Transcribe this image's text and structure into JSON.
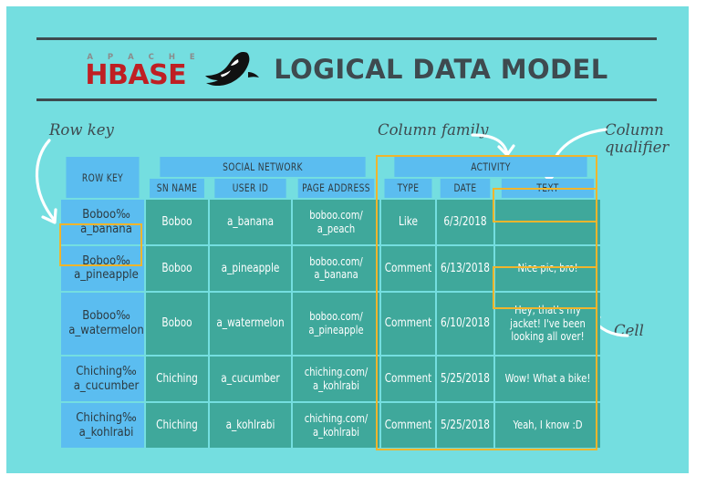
{
  "page": {
    "background": "#ffffff",
    "panel_color": "#74dee0",
    "header_rule_color": "#3e4a4f"
  },
  "header": {
    "logo": {
      "apache": "A P A C H E",
      "hbase": "HBASE",
      "orca_icon": "orca-whale-icon",
      "apache_color": "#8b8b8b",
      "hbase_color": "#bf1f23"
    },
    "title": "LOGICAL DATA MODEL",
    "title_color": "#3e4a4f"
  },
  "annotations": {
    "row_key": "Row key",
    "column_family": "Column family",
    "column_qualifier": "Column\nqualifier",
    "cell": "Cell",
    "highlight_color": "#f0b52c"
  },
  "table": {
    "colors": {
      "header_cell": "#5bbdf0",
      "rowkey_cell": "#5bbdf0",
      "data_cell": "#3fa89b",
      "grid_line": "#ffffff"
    },
    "group_headers": {
      "row_key": "ROW KEY",
      "social_network": "SOCIAL NETWORK",
      "activity": "ACTIVITY"
    },
    "qualifiers": {
      "sn_name": "SN NAME",
      "user_id": "USER ID",
      "page_address": "PAGE ADDRESS",
      "type": "TYPE",
      "date": "DATE",
      "text": "TEXT"
    },
    "rows": [
      {
        "row_key": "Boboo‰\na_banana",
        "sn_name": "Boboo",
        "user_id": "a_banana",
        "page_address": "boboo.com/\na_peach",
        "type": "Like",
        "date": "6/3/2018",
        "text": ""
      },
      {
        "row_key": "Boboo‰\na_pineapple",
        "sn_name": "Boboo",
        "user_id": "a_pineapple",
        "page_address": "boboo.com/\na_banana",
        "type": "Comment",
        "date": "6/13/2018",
        "text": "Nice pic, bro!"
      },
      {
        "row_key": "Boboo‰\na_watermelon",
        "sn_name": "Boboo",
        "user_id": "a_watermelon",
        "page_address": "boboo.com/\na_pineapple",
        "type": "Comment",
        "date": "6/10/2018",
        "text": "Hey, that's my jacket! I've been looking all over!"
      },
      {
        "row_key": "Chiching‰\na_cucumber",
        "sn_name": "Chiching",
        "user_id": "a_cucumber",
        "page_address": "chiching.com/\na_kohlrabi",
        "type": "Comment",
        "date": "5/25/2018",
        "text": "Wow! What a bike!"
      },
      {
        "row_key": "Chiching‰\na_kohlrabi",
        "sn_name": "Chiching",
        "user_id": "a_kohlrabi",
        "page_address": "chiching.com/\na_kohlrabi",
        "type": "Comment",
        "date": "5/25/2018",
        "text": "Yeah, I know :D"
      }
    ]
  }
}
